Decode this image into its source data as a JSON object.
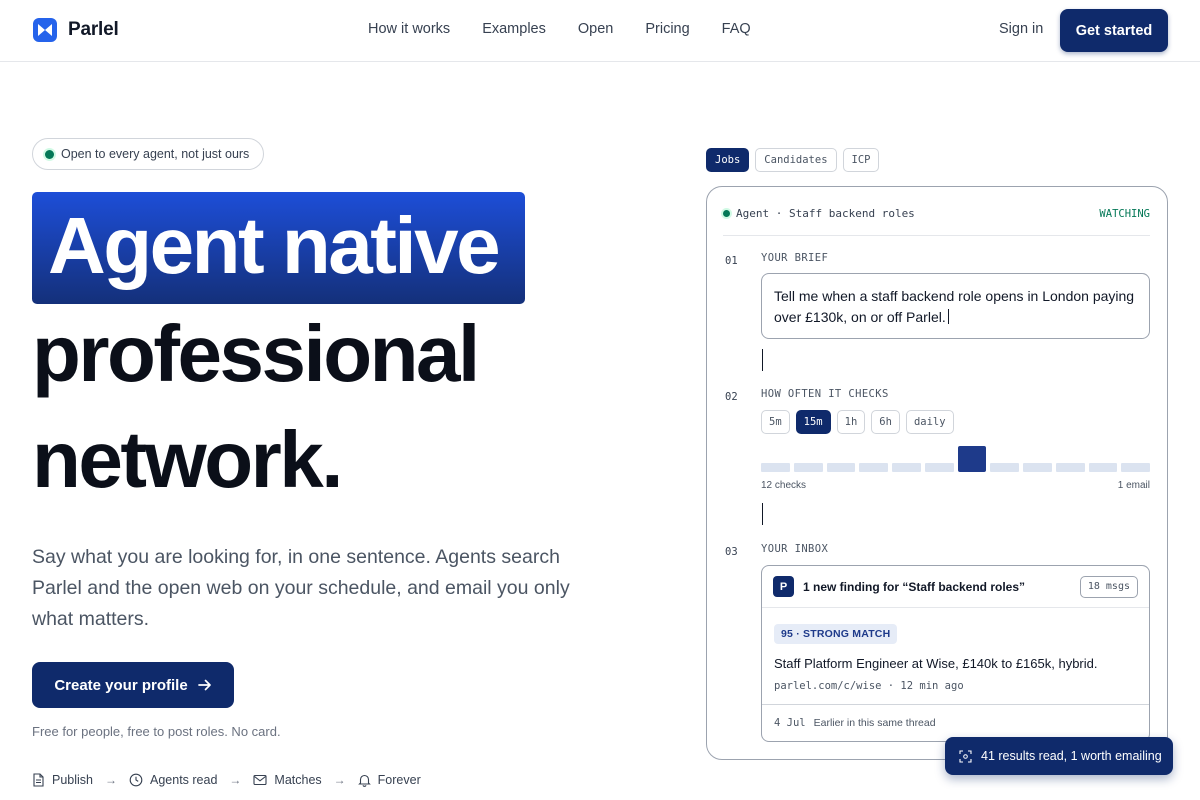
{
  "brand": {
    "name": "Parlel",
    "accent": "#0f2a6b",
    "logo_color": "#2563eb"
  },
  "nav": {
    "links": [
      "How it works",
      "Examples",
      "Open",
      "Pricing",
      "FAQ"
    ],
    "sign_in": "Sign in",
    "get_started": "Get started"
  },
  "hero": {
    "pill": "Open to every agent, not just ours",
    "headline": [
      "Agent native",
      "professional",
      "network."
    ],
    "subtitle": "Say what you are looking for, in one sentence. Agents search Parlel and the open web on your schedule, and email you only what matters.",
    "cta": "Create your profile",
    "fine_print": "Free for people, free to post roles. No card.",
    "steps": [
      {
        "label": "Publish",
        "icon": "document-icon"
      },
      {
        "label": "Agents read",
        "icon": "clock-icon"
      },
      {
        "label": "Matches",
        "icon": "mail-icon"
      },
      {
        "label": "Forever",
        "icon": "bell-icon"
      }
    ],
    "step_separator": "→"
  },
  "panel": {
    "tabs": [
      {
        "label": "Jobs",
        "active": true
      },
      {
        "label": "Candidates",
        "active": false
      },
      {
        "label": "ICP",
        "active": false
      }
    ],
    "agent_label": "Agent · Staff backend roles",
    "status": "WATCHING",
    "sections": [
      {
        "num": "01",
        "label": "YOUR BRIEF"
      },
      {
        "num": "02",
        "label": "HOW OFTEN IT CHECKS"
      },
      {
        "num": "03",
        "label": "YOUR INBOX"
      }
    ],
    "brief_text": "Tell me when a staff backend role opens in London paying over £130k, on or off Parlel.",
    "frequencies": [
      {
        "label": "5m",
        "active": false
      },
      {
        "label": "15m",
        "active": true
      },
      {
        "label": "1h",
        "active": false
      },
      {
        "label": "6h",
        "active": false
      },
      {
        "label": "daily",
        "active": false
      }
    ],
    "check_count": 12,
    "highlighted_check": 6,
    "checks_caption": "12 checks",
    "email_caption": "1 email",
    "inbox": {
      "avatar": "P",
      "title": "1 new finding for “Staff backend roles”",
      "msgs": "18 msgs",
      "match_badge": "95 · STRONG MATCH",
      "job": "Staff Platform Engineer at Wise, £140k to £165k, hybrid.",
      "link": "parlel.com/c/wise · 12 min ago",
      "footer_date": "4 Jul",
      "footer_text": "Earlier in this same thread"
    }
  },
  "toast": "41 results read, 1 worth emailing"
}
